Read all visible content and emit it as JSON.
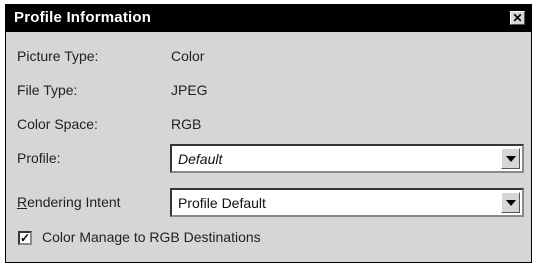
{
  "window": {
    "title": "Profile Information",
    "close_glyph": "✕"
  },
  "fields": {
    "picture_type": {
      "label": "Picture Type:",
      "value": "Color"
    },
    "file_type": {
      "label": "File Type:",
      "value": "JPEG"
    },
    "color_space": {
      "label": "Color Space:",
      "value": "RGB"
    }
  },
  "profile": {
    "label": "Profile:",
    "selected": "Default"
  },
  "rendering_intent": {
    "label": "Rendering Intent",
    "selected": "Profile Default"
  },
  "color_manage": {
    "label": "Color Manage to RGB Destinations",
    "checked": true,
    "check_glyph": "✓"
  },
  "colors": {
    "titlebar": "#000000",
    "window_bg": "#d6d6d6"
  },
  "icons": {
    "close": "close-icon",
    "dropdown": "chevron-down-icon"
  }
}
